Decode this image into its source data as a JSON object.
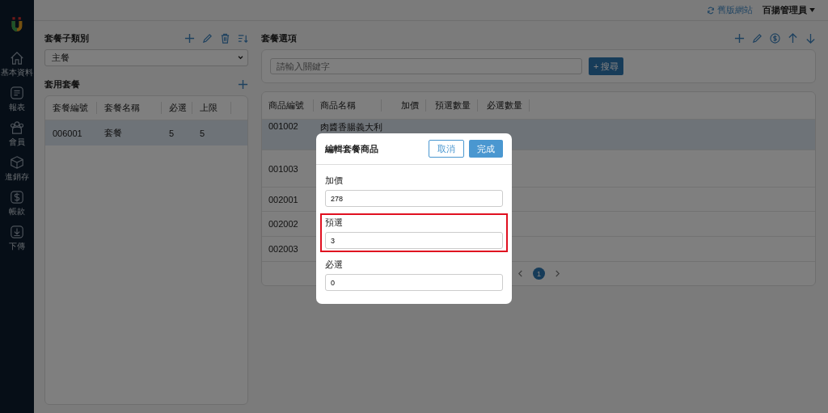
{
  "sidebar": {
    "items": [
      {
        "label": "基本資料",
        "kind": "home"
      },
      {
        "label": "報表",
        "kind": "report"
      },
      {
        "label": "會員",
        "kind": "members"
      },
      {
        "label": "進銷存",
        "kind": "box"
      },
      {
        "label": "帳款",
        "kind": "dollar"
      },
      {
        "label": "下傳",
        "kind": "download"
      }
    ]
  },
  "header": {
    "old_site_link": "舊版網站",
    "user": "百揚管理員"
  },
  "left_panel": {
    "subcategory_title": "套餐子類別",
    "subcategory_select": "主餐",
    "applied_title": "套用套餐",
    "table": {
      "columns": [
        "套餐編號",
        "套餐名稱",
        "必選",
        "上限"
      ],
      "rows": [
        {
          "cells": [
            "006001",
            "套餐",
            "5",
            "5"
          ],
          "selected": true
        }
      ]
    }
  },
  "right_panel": {
    "title": "套餐選項",
    "search": {
      "placeholder": "請輸入關鍵字",
      "button": "+ 搜尋"
    },
    "table": {
      "columns": [
        "商品編號",
        "商品名稱",
        "加價",
        "預選數量",
        "必選數量"
      ],
      "rows": [
        {
          "cells": [
            "001002",
            "肉醬香腸義大利"
          ],
          "selected": true
        },
        {
          "cells": [
            "001003"
          ],
          "selected": false
        },
        {
          "cells": [
            "002001"
          ],
          "selected": false
        },
        {
          "cells": [
            "002002"
          ],
          "selected": false
        },
        {
          "cells": [
            "002003"
          ],
          "selected": false
        }
      ]
    },
    "pagination": {
      "pages": [
        {
          "label": "1",
          "selected": true
        }
      ]
    }
  },
  "modal": {
    "title": "編輯套餐商品",
    "cancel": "取消",
    "confirm": "完成",
    "fields": [
      {
        "label": "加價",
        "value": "278",
        "highlighted": false
      },
      {
        "label": "預選",
        "value": "3",
        "highlighted": true
      },
      {
        "label": "必選",
        "value": "0",
        "highlighted": false
      }
    ]
  }
}
